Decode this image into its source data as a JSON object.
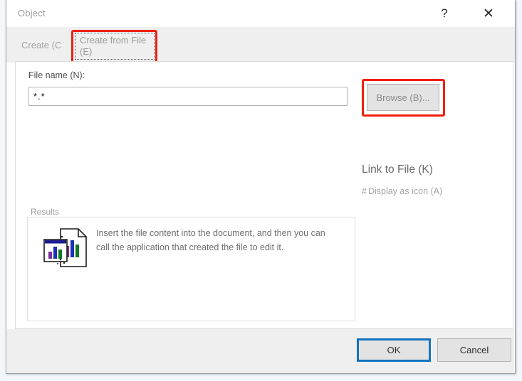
{
  "window": {
    "title": "Object",
    "help_icon": "?",
    "close_icon": "✕"
  },
  "tabs": [
    {
      "id": "create",
      "label": "Create (C",
      "selected": false
    },
    {
      "id": "create-from-file",
      "label": "Create from File (E)",
      "selected": true,
      "focused": true,
      "highlighted": true
    }
  ],
  "form": {
    "file_name_label": "File name (N):",
    "file_name_value": "*.*",
    "file_name_placeholder": "",
    "browse_label": "Browse (B)...",
    "browse_highlighted": true
  },
  "options": {
    "link_to_file_label": "Link to File (K)",
    "display_as_icon_label": "Display as icon (A)",
    "display_as_icon_prefix": "#"
  },
  "results": {
    "legend": "Results",
    "description": "Insert the file content into the document, and then you can call the application that created the file to edit it.",
    "icon_name": "document-with-chart-icon"
  },
  "footer": {
    "ok_label": "OK",
    "cancel_label": "Cancel"
  },
  "colors": {
    "highlight_red": "#f01f0e",
    "focus_blue": "#1373bd",
    "tabstrip_bg": "#efefef",
    "panel_bg": "#ffffff",
    "button_bg": "#e3e3e3"
  }
}
